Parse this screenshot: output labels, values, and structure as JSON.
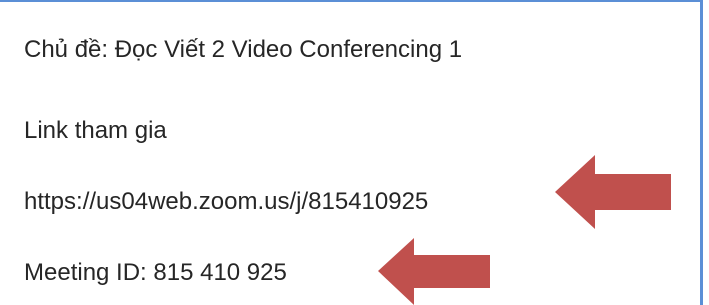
{
  "content": {
    "topic": "Chủ đề: Đọc Viết 2 Video Conferencing 1",
    "link_label": "Link tham gia",
    "link_url": "https://us04web.zoom.us/j/815410925",
    "meeting_id": "Meeting ID: 815 410 925"
  },
  "annotations": {
    "arrow_color": "#c0504d",
    "arrow_icon": "left-arrow-icon",
    "frame_border_color": "#5b8fd6"
  }
}
